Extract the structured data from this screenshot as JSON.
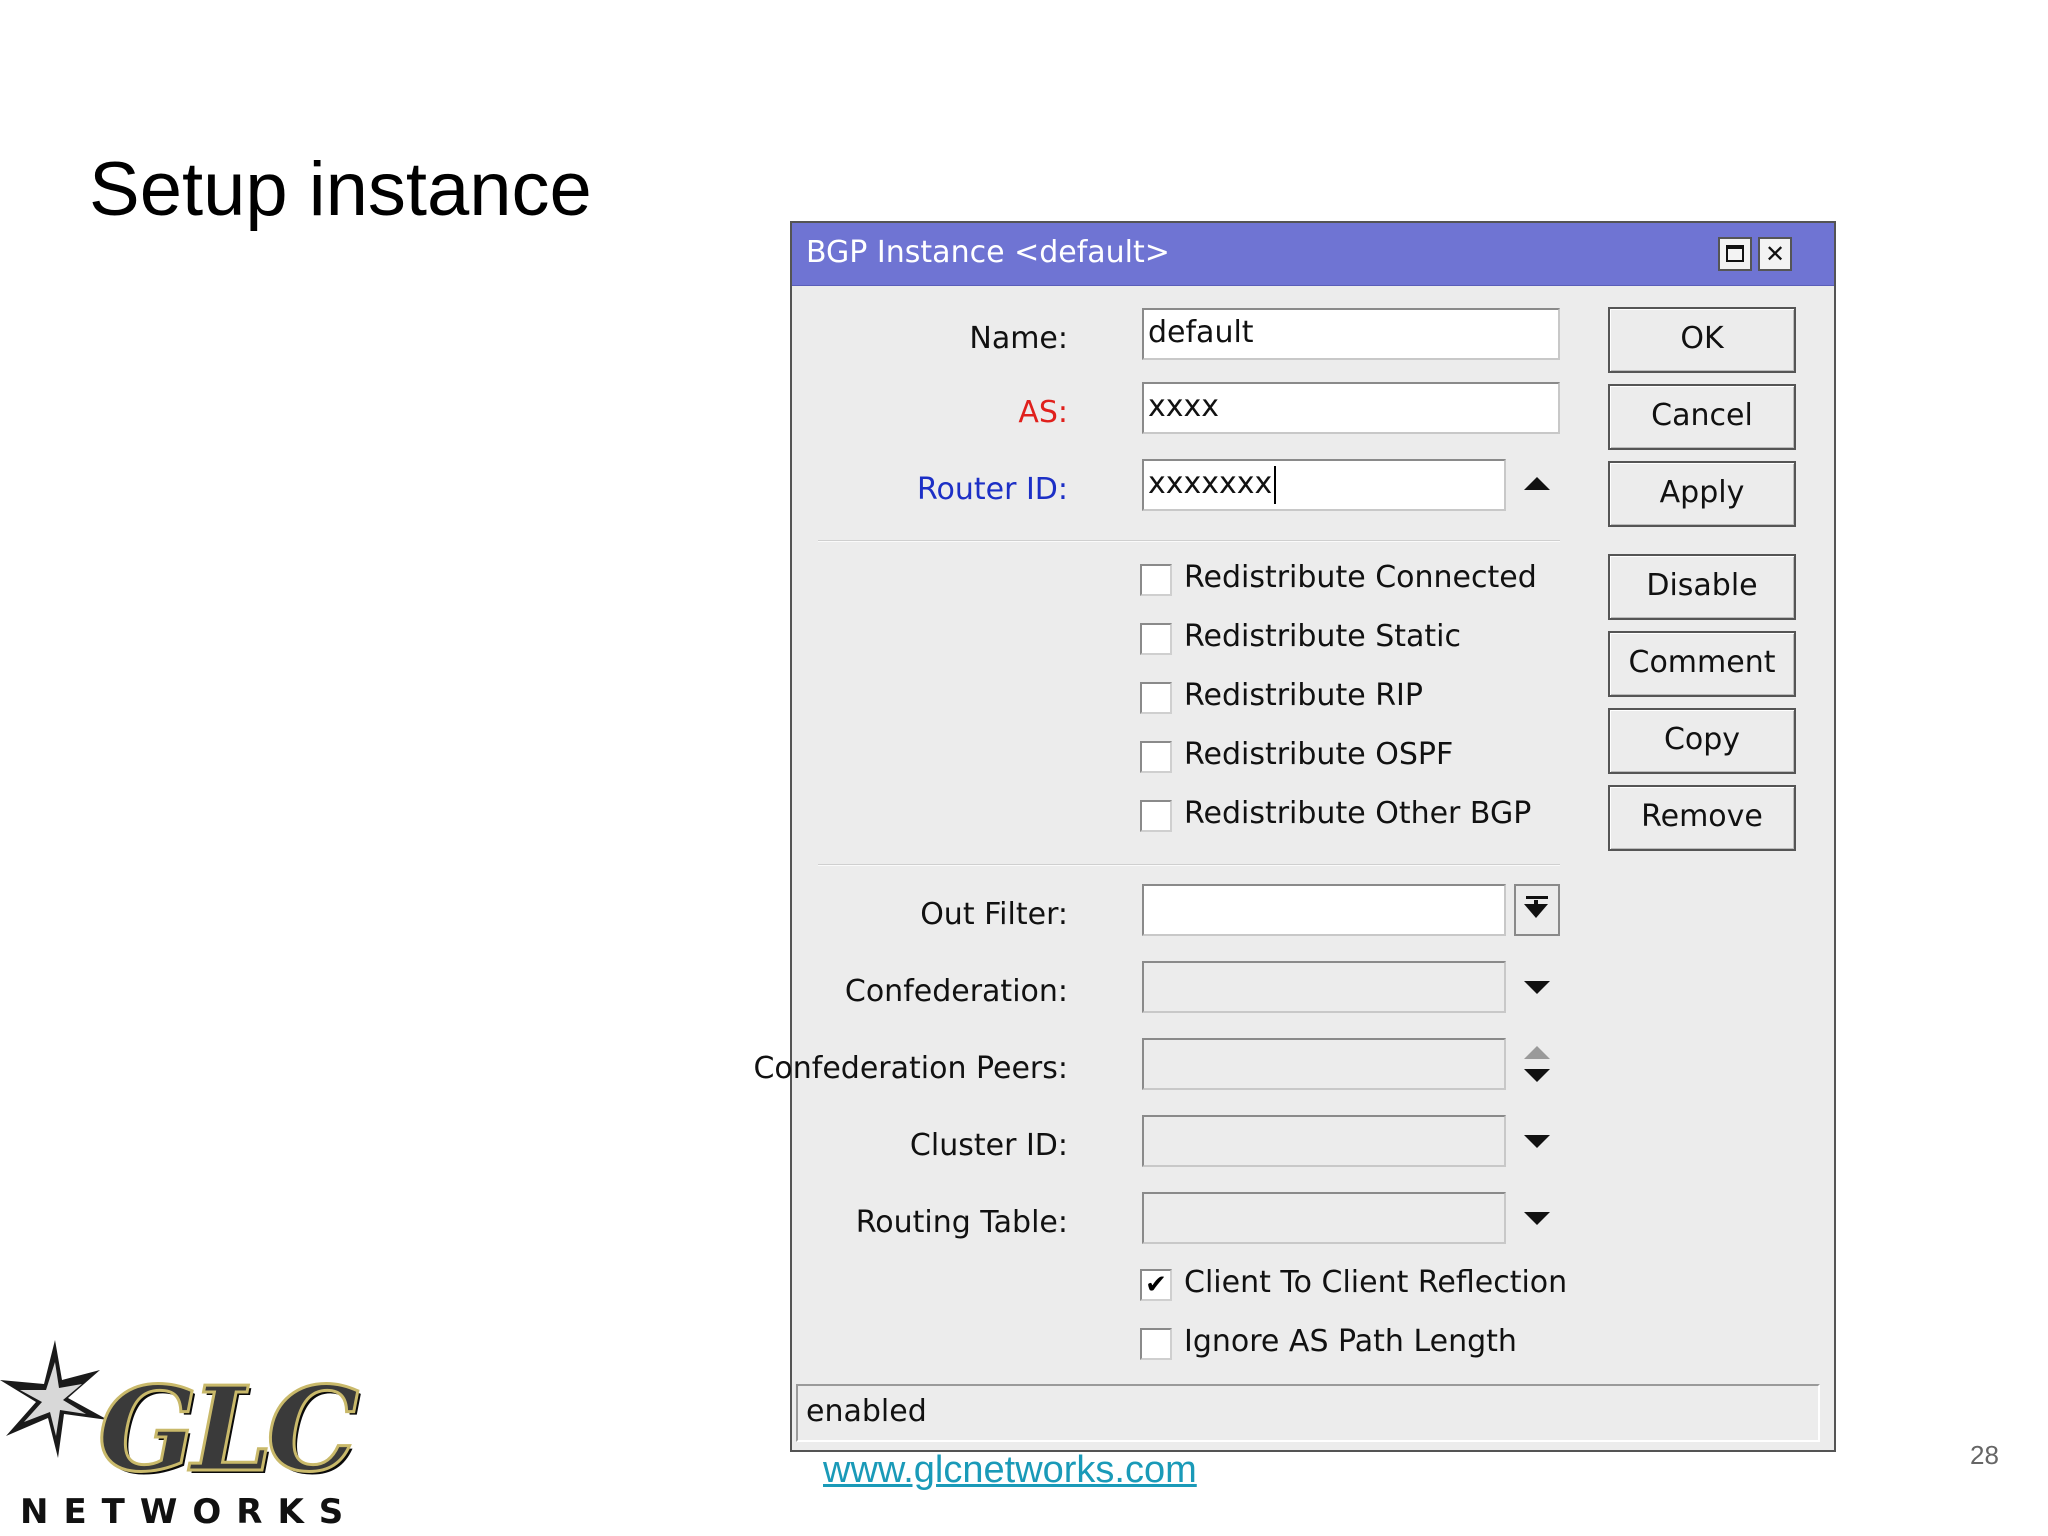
{
  "slide": {
    "title": "Setup instance",
    "page_number": "28",
    "footer_link": "www.glcnetworks.com",
    "logo": {
      "wordmark": "GLC",
      "subtitle": "NETWORKS"
    }
  },
  "window": {
    "title": "BGP Instance <default>",
    "titlebar_color": "#6f74d3",
    "fields": {
      "name": {
        "label": "Name:",
        "value": "default"
      },
      "as": {
        "label": "AS:",
        "value": "xxxx",
        "label_color": "#e0201c"
      },
      "router_id": {
        "label": "Router ID:",
        "value": "xxxxxxx",
        "label_color": "#1c2fc6"
      },
      "out_filter": {
        "label": "Out Filter:",
        "value": ""
      },
      "confederation": {
        "label": "Confederation:",
        "value": ""
      },
      "confederation_peers": {
        "label": "Confederation Peers:",
        "value": ""
      },
      "cluster_id": {
        "label": "Cluster ID:",
        "value": ""
      },
      "routing_table": {
        "label": "Routing Table:",
        "value": ""
      }
    },
    "checkboxes": [
      {
        "label": "Redistribute Connected",
        "checked": false
      },
      {
        "label": "Redistribute Static",
        "checked": false
      },
      {
        "label": "Redistribute RIP",
        "checked": false
      },
      {
        "label": "Redistribute OSPF",
        "checked": false
      },
      {
        "label": "Redistribute Other BGP",
        "checked": false
      },
      {
        "label": "Client To Client Reflection",
        "checked": true
      },
      {
        "label": "Ignore AS Path Length",
        "checked": false
      }
    ],
    "buttons": {
      "ok": "OK",
      "cancel": "Cancel",
      "apply": "Apply",
      "disable": "Disable",
      "comment": "Comment",
      "copy": "Copy",
      "remove": "Remove"
    },
    "status": "enabled"
  }
}
